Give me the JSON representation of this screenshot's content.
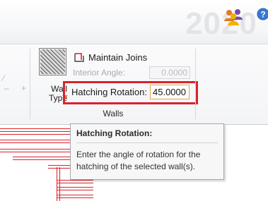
{
  "header": {
    "brand_text": "2020",
    "icons": [
      "users-icon",
      "help-icon"
    ],
    "help_glyph": "?"
  },
  "ribbon": {
    "wall_type": {
      "label": "Wall\nType",
      "icon": "wall-hatch-pattern-icon",
      "dropdown_icon": "dropdown-arrow-icon"
    },
    "maintain_joins": {
      "label": "Maintain Joins",
      "icon": "maintain-joins-icon"
    },
    "interior_angle": {
      "label": "Interior Angle:",
      "value": "0.0000",
      "enabled": false
    },
    "hatching_rotation": {
      "label": "Hatching Rotation:",
      "value": "45.0000"
    },
    "group_label": "Walls",
    "colors": {
      "highlight_border": "#d9232b",
      "active_input_border": "#e9a44c",
      "dropdown_arrow": "#d9822b"
    }
  },
  "tooltip": {
    "title": "Hatching Rotation:",
    "body": "Enter the angle of rotation for the hatching of the selected wall(s)."
  },
  "canvas": {
    "line_color": "#d9232b"
  }
}
